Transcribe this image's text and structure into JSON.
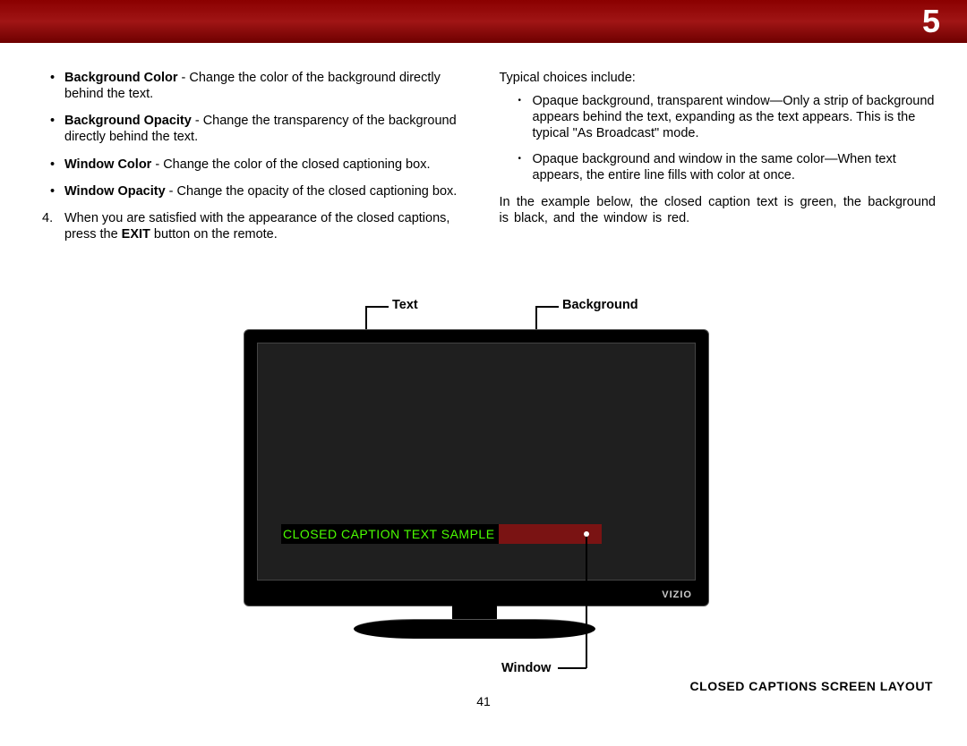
{
  "chapter": "5",
  "page_number": "41",
  "left_column": {
    "items": [
      {
        "term": "Background Color",
        "desc": " - Change the color of the background directly behind the text."
      },
      {
        "term": "Background Opacity",
        "desc": " - Change the transparency of the background directly behind the text."
      },
      {
        "term": "Window Color",
        "desc": " - Change the color of the closed captioning box."
      },
      {
        "term": "Window Opacity",
        "desc": " - Change the opacity of the closed captioning box."
      }
    ],
    "step4_prefix": "When you are satisfied with the appearance of the closed captions, press the ",
    "step4_bold": "EXIT",
    "step4_suffix": " button on the remote.",
    "step4_num": "4."
  },
  "right_column": {
    "intro": "Typical choices include:",
    "choices": [
      "Opaque background, transparent window—Only a strip of background appears behind the text, expanding as the text appears. This is the typical \"As Broadcast\" mode.",
      "Opaque background and window in the same color—When text appears, the entire line fills with color at once."
    ],
    "example": "In the example below, the closed caption text is green, the background is black, and the window is red."
  },
  "labels": {
    "text": "Text",
    "background": "Background",
    "window": "Window"
  },
  "tv": {
    "brand": "VIZIO",
    "caption_sample": "CLOSED CAPTION TEXT SAMPLE"
  },
  "footer_caption": "CLOSED CAPTIONS SCREEN LAYOUT"
}
